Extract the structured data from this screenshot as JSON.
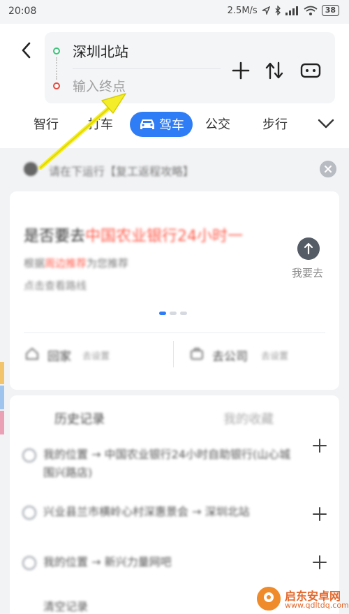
{
  "status": {
    "time": "20:08",
    "network_speed": "2.5M/s",
    "battery": "38"
  },
  "route": {
    "start": "深圳北站",
    "end_placeholder": "输入终点"
  },
  "tabs": [
    {
      "label": "智行"
    },
    {
      "label": "打车"
    },
    {
      "label": "驾车"
    },
    {
      "label": "公交"
    },
    {
      "label": "步行"
    }
  ],
  "notice": {
    "text": "请在下运行【复工返程攻略】"
  },
  "promo": {
    "title_prefix": "是否要去",
    "title_highlight": "中国农业银行24小时一",
    "line1_prefix": "根据",
    "line1_highlight": "周边推荐",
    "line1_suffix": "为您推荐",
    "line2": "点击查看路线",
    "go_label": "我要去"
  },
  "shortcuts": {
    "home": {
      "label": "回家",
      "hint": "去设置"
    },
    "work": {
      "label": "去公司",
      "hint": "去设置"
    }
  },
  "history": {
    "tab_history": "历史记录",
    "tab_favorites": "我的收藏",
    "rows": [
      {
        "text": "我的位置 → 中国农业银行24小时自助银行(山心城围兴路店)"
      },
      {
        "text": "兴业县兰市横岭心村深惠景会 → 深圳北站"
      },
      {
        "text": "我的位置 → 新兴力量网吧"
      },
      {
        "text": "清空记录"
      }
    ]
  },
  "watermark": {
    "title": "启东安卓网",
    "url": "www.qdltdq.com"
  }
}
